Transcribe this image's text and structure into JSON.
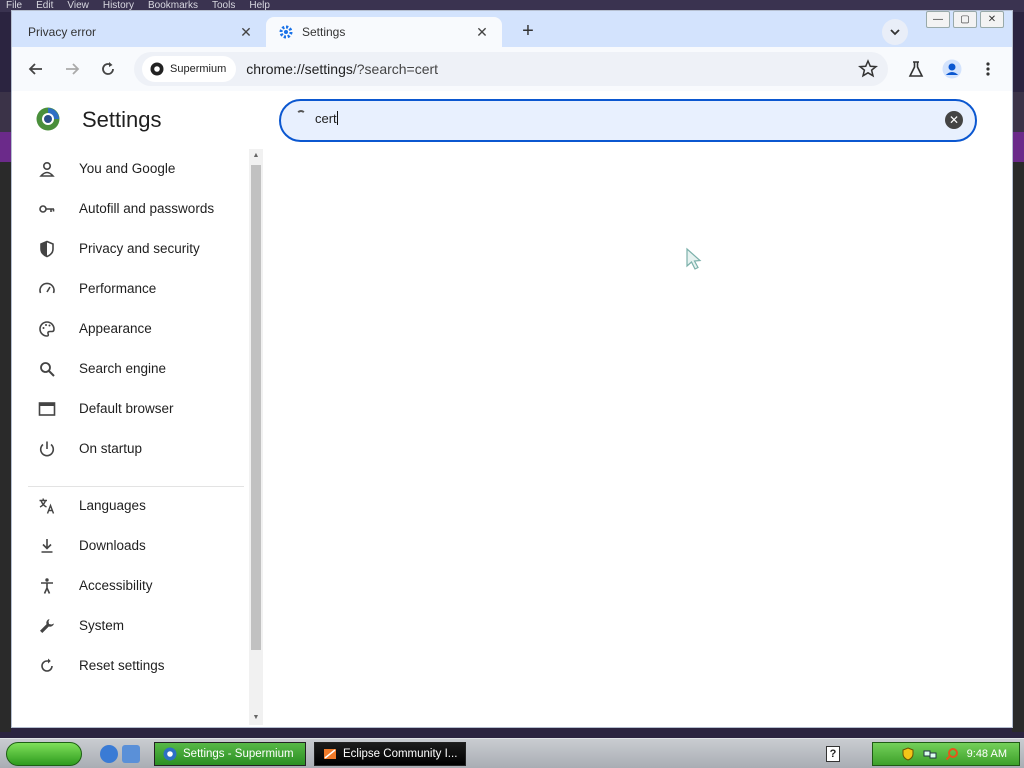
{
  "background": {
    "menu": [
      "File",
      "Edit",
      "View",
      "History",
      "Bookmarks",
      "Tools",
      "Help"
    ]
  },
  "tabs": [
    {
      "title": "Privacy error",
      "active": false
    },
    {
      "title": "Settings",
      "active": true
    }
  ],
  "toolbar": {
    "site_chip_label": "Supermium",
    "url_host": "chrome://settings",
    "url_rest": "/?search=cert"
  },
  "settings": {
    "title": "Settings",
    "search": {
      "value": "cert"
    },
    "nav": [
      {
        "label": "You and Google",
        "icon": "person-icon"
      },
      {
        "label": "Autofill and passwords",
        "icon": "key-icon"
      },
      {
        "label": "Privacy and security",
        "icon": "shield-icon"
      },
      {
        "label": "Performance",
        "icon": "speedometer-icon"
      },
      {
        "label": "Appearance",
        "icon": "palette-icon"
      },
      {
        "label": "Search engine",
        "icon": "search-icon"
      },
      {
        "label": "Default browser",
        "icon": "browser-window-icon"
      },
      {
        "label": "On startup",
        "icon": "power-icon"
      },
      {
        "label": "Languages",
        "icon": "translate-icon"
      },
      {
        "label": "Downloads",
        "icon": "download-icon"
      },
      {
        "label": "Accessibility",
        "icon": "accessibility-icon"
      },
      {
        "label": "System",
        "icon": "wrench-icon"
      },
      {
        "label": "Reset settings",
        "icon": "reset-icon"
      }
    ]
  },
  "taskbar": {
    "tasks": [
      {
        "label": "Settings - Supermium"
      },
      {
        "label": "Eclipse Community I..."
      }
    ],
    "clock": "9:48 AM"
  },
  "colors": {
    "accent": "#0b57d0",
    "tabstrip": "#d3e3fd",
    "taskbar_green": "#3da02a"
  }
}
